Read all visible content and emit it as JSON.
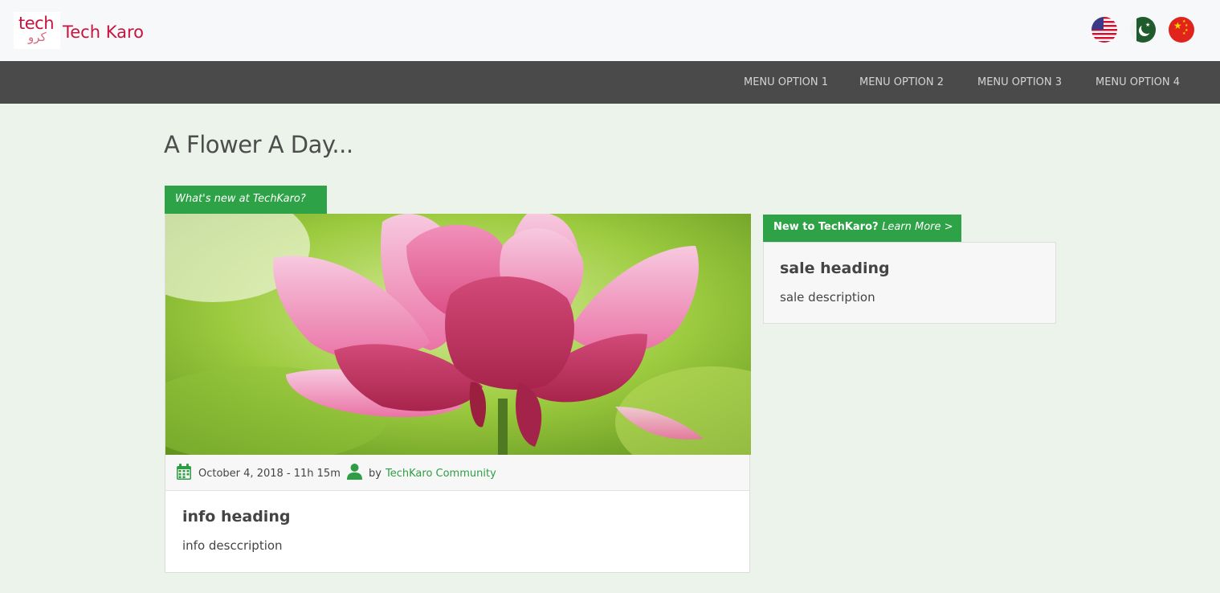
{
  "header": {
    "logo": {
      "text_top": "tech",
      "text_bottom": "کرو"
    },
    "brand": "Tech Karo",
    "flags": [
      {
        "name": "united-states-flag"
      },
      {
        "name": "pakistan-flag"
      },
      {
        "name": "china-flag"
      }
    ]
  },
  "nav": {
    "items": [
      "MENU OPTION 1",
      "MENU OPTION 2",
      "MENU OPTION 3",
      "MENU OPTION 4"
    ]
  },
  "main": {
    "title": "A Flower A Day...",
    "news_tag": "What's new at TechKaro?",
    "card": {
      "image": "pink lotus flower on green background",
      "date": "October 4, 2018 - 11h 15m",
      "by_label": "by",
      "author": "TechKaro Community",
      "heading": "info heading",
      "description": "info desccription"
    },
    "learn_tag": {
      "label": "New to TechKaro?",
      "link": "Learn More >"
    },
    "sale": {
      "heading": "sale heading",
      "description": "sale description"
    }
  },
  "colors": {
    "brand": "#c8143e",
    "accent_green": "#2da246",
    "navbar": "#4a4a4a",
    "page_bg": "#ebf3ea"
  },
  "icons": [
    "calendar-icon",
    "user-icon"
  ]
}
